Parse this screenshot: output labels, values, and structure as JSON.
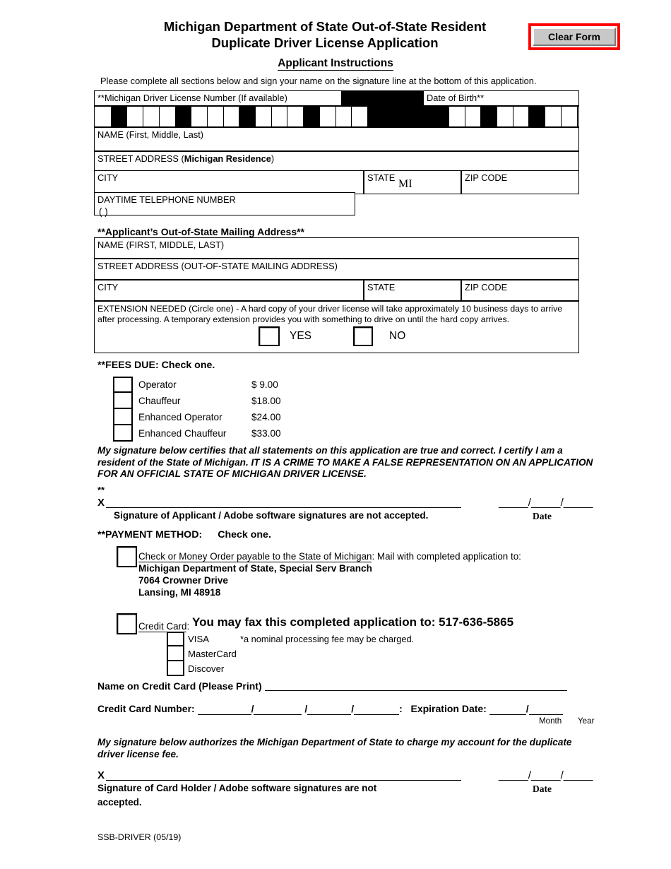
{
  "header": {
    "title_line1": "Michigan Department of State Out-of-State Resident",
    "title_line2": "Duplicate Driver License Application",
    "clear_form_label": "Clear Form",
    "instructions_heading": "Applicant Instructions",
    "instructions_text": "Please complete all sections below and sign your name on the signature line at the bottom of this application."
  },
  "michigan_block": {
    "dl_number_label": "**Michigan Driver License Number (If available)",
    "dob_label": "Date of Birth**",
    "name_label": "NAME (First, Middle, Last)",
    "street_label_prefix": "STREET ADDRESS (",
    "street_label_bold": "Michigan Residence",
    "street_label_suffix": ")",
    "city_label": "CITY",
    "state_label": "STATE",
    "state_value": "MI",
    "zip_label": "ZIP CODE",
    "phone_label": "DAYTIME TELEPHONE NUMBER",
    "phone_parens": "(            )"
  },
  "mailing_block": {
    "heading": "**Applicant’s Out-of-State Mailing Address**",
    "name_label": "NAME (FIRST, MIDDLE, LAST)",
    "street_label": "STREET ADDRESS (OUT-OF-STATE MAILING ADDRESS)",
    "city_label": "CITY",
    "state_label": "STATE",
    "zip_label": "ZIP CODE",
    "extension_text": "EXTENSION NEEDED (Circle one) - A hard copy of your driver license will take approximately 10 business days to arrive after processing.  A temporary extension provides you with something to drive on until the hard copy arrives.",
    "yes_label": "YES",
    "no_label": "NO"
  },
  "fees": {
    "heading": "**FEES DUE:  Check one.",
    "items": [
      {
        "label": "Operator",
        "amount": "$  9.00"
      },
      {
        "label": "Chauffeur",
        "amount": "$18.00"
      },
      {
        "label": "Enhanced Operator",
        "amount": "$24.00"
      },
      {
        "label": "Enhanced Chauffeur",
        "amount": "$33.00"
      }
    ]
  },
  "certification": {
    "text": "My signature below certifies that all statements on this application are true and correct. I certify I am a resident of the State of Michigan.  IT IS A CRIME TO MAKE A FALSE REPRESENTATION ON AN APPLICATION FOR AN OFFICIAL STATE OF MICHIGAN DRIVER LICENSE.",
    "stars": "**",
    "x_mark": "X",
    "caption": "Signature of Applicant / Adobe software signatures are not accepted.",
    "date_slashes": "_____/_____/_____",
    "date_word": "Date"
  },
  "payment": {
    "heading_label": "**PAYMENT METHOD:",
    "heading_check": "Check one.",
    "check_option_underlined": "Check or Money Order payable to the State of Michigan",
    "check_option_rest": ":  Mail with completed application to:",
    "address_line1": "Michigan Department of State,  Special Serv Branch",
    "address_line2": "7064 Crowner Drive",
    "address_line3": " Lansing, MI  48918",
    "credit_card_underlined": "Credit Card",
    "credit_card_colon": ":",
    "fax_text": "You may fax this completed application to:  517-636-5865",
    "cards": [
      {
        "label": "VISA",
        "note": "*a nominal processing fee may be charged."
      },
      {
        "label": "MasterCard",
        "note": ""
      },
      {
        "label": "Discover",
        "note": ""
      }
    ],
    "name_on_card_label": "Name on Credit Card (Please Print)",
    "cc_number_label": "Credit Card Number:",
    "cc_number_colon": ":",
    "expiration_label": "Expiration Date:",
    "month_label": "Month",
    "year_label": "Year"
  },
  "authorization": {
    "text": "My signature below authorizes the Michigan Department of State to charge my account for the duplicate driver license fee.",
    "x_mark": "X",
    "caption_line1": "Signature of Card Holder / Adobe software signatures are not",
    "caption_line2": "accepted.",
    "date_slashes": "_____/_____/_____",
    "date_word": "Date"
  },
  "footer": {
    "form_id": "SSB-DRIVER (05/19)"
  },
  "colors": {
    "accent_red": "#ff0000",
    "button_face": "#c8c8c8",
    "ink": "#000000"
  },
  "dl_grid": {
    "license_pattern": [
      "w",
      "b",
      "w",
      "w",
      "w",
      "b",
      "w",
      "w",
      "w",
      "b",
      "w",
      "w",
      "w",
      "b",
      "w",
      "w",
      "w"
    ],
    "separator": "black",
    "dob_pattern": [
      "w",
      "w",
      "b",
      "w",
      "w",
      "b",
      "w",
      "w",
      "w",
      "w"
    ]
  }
}
